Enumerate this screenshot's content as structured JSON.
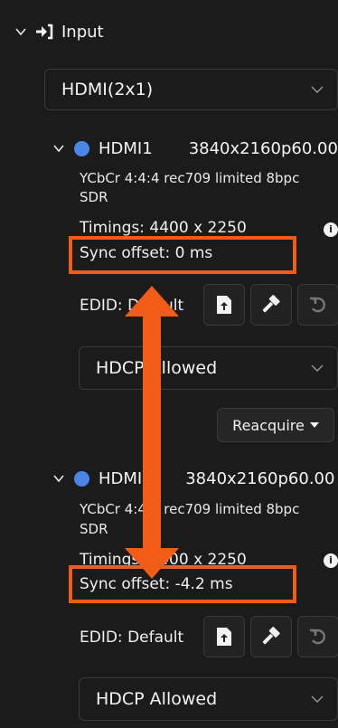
{
  "section": {
    "title": "Input"
  },
  "input_dropdown": {
    "value": "HDMI(2x1)"
  },
  "sources": [
    {
      "name": "HDMI1",
      "resolution": "3840x2160p60.00",
      "color_format": "YCbCr 4:4:4 rec709 limited 8bpc",
      "dynamic_range": "SDR",
      "timings": "Timings: 4400 x 2250",
      "sync_offset": "Sync offset:  0 ms",
      "edid": "EDID: Default",
      "hdcp": "HDCP Allowed"
    },
    {
      "name": "HDMI",
      "resolution": "3840x2160p60.00",
      "color_format": "YCbCr 4:4:4 rec709 limited 8bpc",
      "dynamic_range": "SDR",
      "timings": "Timings: 4400 x 2250",
      "sync_offset": "Sync offset: -4.2 ms",
      "edid": "EDID: Default",
      "hdcp": "HDCP Allowed"
    }
  ],
  "reacquire": {
    "label": "Reacquire"
  },
  "colors": {
    "background": "#1b1b1b",
    "highlight": "#f25c17",
    "source_dot": "#4a86e8"
  },
  "icons": {
    "section_chevron": "chevron-down-icon",
    "section_icon": "sign-in-icon",
    "upload": "file-upload-icon",
    "hammer": "hammer-icon",
    "reset": "undo-icon",
    "info": "info-icon",
    "caret": "caret-down-icon",
    "arrow": "double-headed-arrow"
  }
}
